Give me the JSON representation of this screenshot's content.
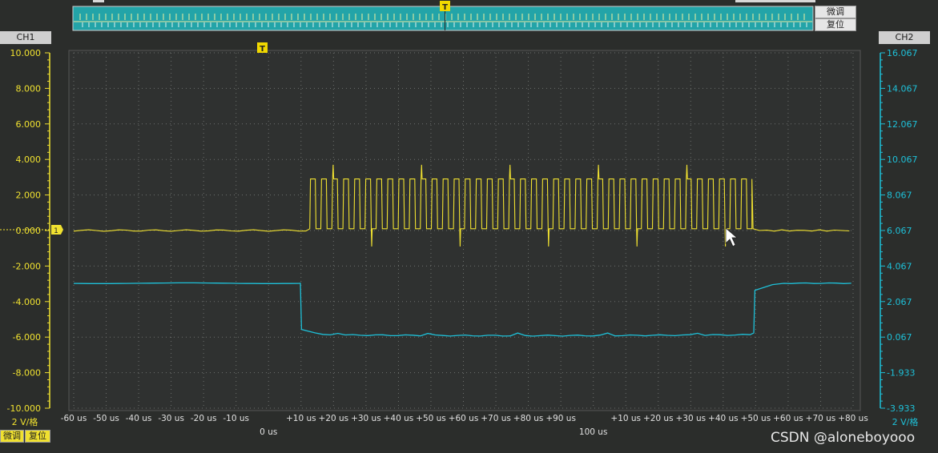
{
  "colors": {
    "background": "#2b2d2b",
    "plot_bg": "#2f3130",
    "ch1": "#f0e130",
    "ch2": "#1ec0d8",
    "grid": "#6e716e",
    "nav_bg": "#23a4a8",
    "text_white": "#ffffff"
  },
  "navigator": {
    "fine_tune_label": "微调",
    "reset_label": "复位",
    "trigger_marker": "T"
  },
  "ch1": {
    "label": "CH1",
    "scale_label": "2 V/格",
    "fine_tune_label": "微调",
    "reset_label": "复位",
    "ticks": [
      "10.000",
      "8.000",
      "6.000",
      "4.000",
      "2.000",
      "0.000",
      "-2.000",
      "-4.000",
      "-6.000",
      "-8.000",
      "-10.000"
    ],
    "ground_marker": "1"
  },
  "ch2": {
    "label": "CH2",
    "scale_label": "2 V/格",
    "ticks": [
      "16.067",
      "14.067",
      "12.067",
      "10.067",
      "8.067",
      "6.067",
      "4.067",
      "2.067",
      "0.067",
      "-1.933",
      "-3.933"
    ]
  },
  "trigger_marker": "T",
  "watermark": "CSDN @aloneboyooo",
  "chart_data": {
    "type": "line",
    "x_ticks": [
      "-60 us",
      "-50 us",
      "-40 us",
      "-30 us",
      "-20 us",
      "-10 us",
      "+10 us",
      "+20 us",
      "+30 us",
      "+40 us",
      "+50 us",
      "+60 us",
      "+70 us",
      "+80 us",
      "+90 us",
      "+10 us",
      "+20 us",
      "+30 us",
      "+40 us",
      "+50 us",
      "+60 us",
      "+70 us",
      "+80 us"
    ],
    "x_major_labels": [
      "0 us",
      "100 us"
    ],
    "y_ticks_left": [
      "10.000",
      "8.000",
      "6.000",
      "4.000",
      "2.000",
      "0.000",
      "-2.000",
      "-4.000",
      "-6.000",
      "-8.000",
      "-10.000"
    ],
    "y_ticks_right": [
      "16.067",
      "14.067",
      "12.067",
      "10.067",
      "8.067",
      "6.067",
      "4.067",
      "2.067",
      "0.067",
      "-1.933",
      "-3.933"
    ],
    "ylim_left": [
      -10,
      10
    ],
    "ylim_right": [
      -3.933,
      16.067
    ],
    "xlim_us": [
      -63,
      145
    ],
    "grid": true,
    "series": [
      {
        "name": "CH1",
        "axis": "left",
        "baseline": 0.0,
        "high": 2.9,
        "low": 0.1,
        "start_us": 0,
        "end_us": 118,
        "pulse_count": 40,
        "spike_max": 3.7,
        "spike_min": -0.9
      },
      {
        "name": "CH2",
        "axis": "right",
        "idle": 3.1,
        "active": 0.2,
        "fall_us": -2.5,
        "rise_us": 118.5
      }
    ]
  }
}
